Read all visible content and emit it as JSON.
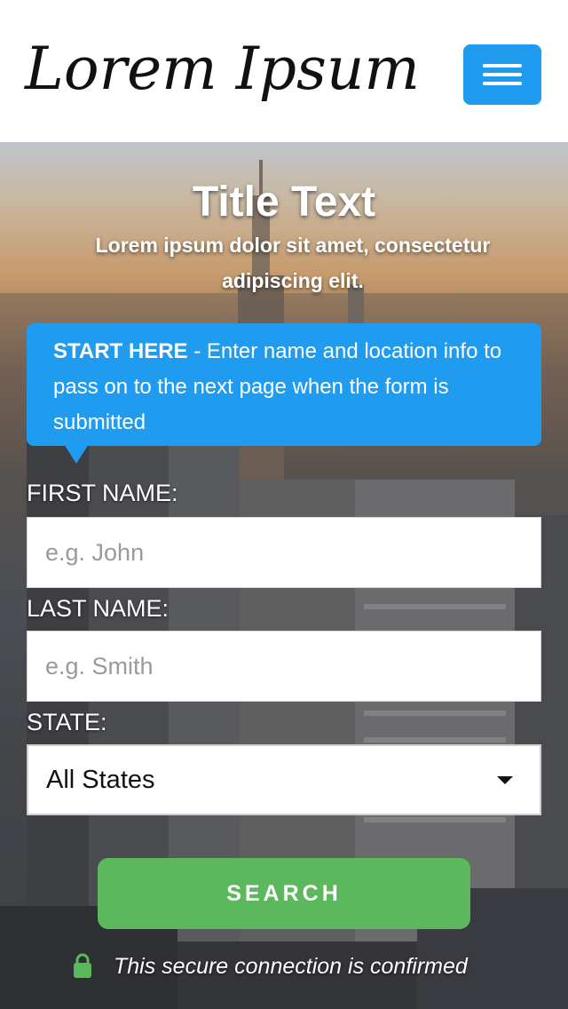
{
  "header": {
    "logo_text": "Lorem Ipsum",
    "menu_icon": "hamburger-menu-icon"
  },
  "hero": {
    "title": "Title Text",
    "subtitle": "Lorem ipsum dolor sit amet, consectetur adipiscing elit."
  },
  "callout": {
    "strong": "START HERE",
    "separator": " - ",
    "text": "Enter name and location info to pass on to the next page when the form is submitted"
  },
  "form": {
    "first_name_label": "FIRST NAME:",
    "first_name_placeholder": "e.g. John",
    "last_name_label": "LAST NAME:",
    "last_name_placeholder": "e.g. Smith",
    "state_label": "STATE:",
    "state_selected": "All States",
    "search_label": "SEARCH"
  },
  "secure": {
    "icon": "lock-icon",
    "text": "This secure connection is confirmed"
  },
  "colors": {
    "accent_blue": "#1f9bf0",
    "button_green": "#5cb85c",
    "lock_green": "#5cb85c"
  }
}
